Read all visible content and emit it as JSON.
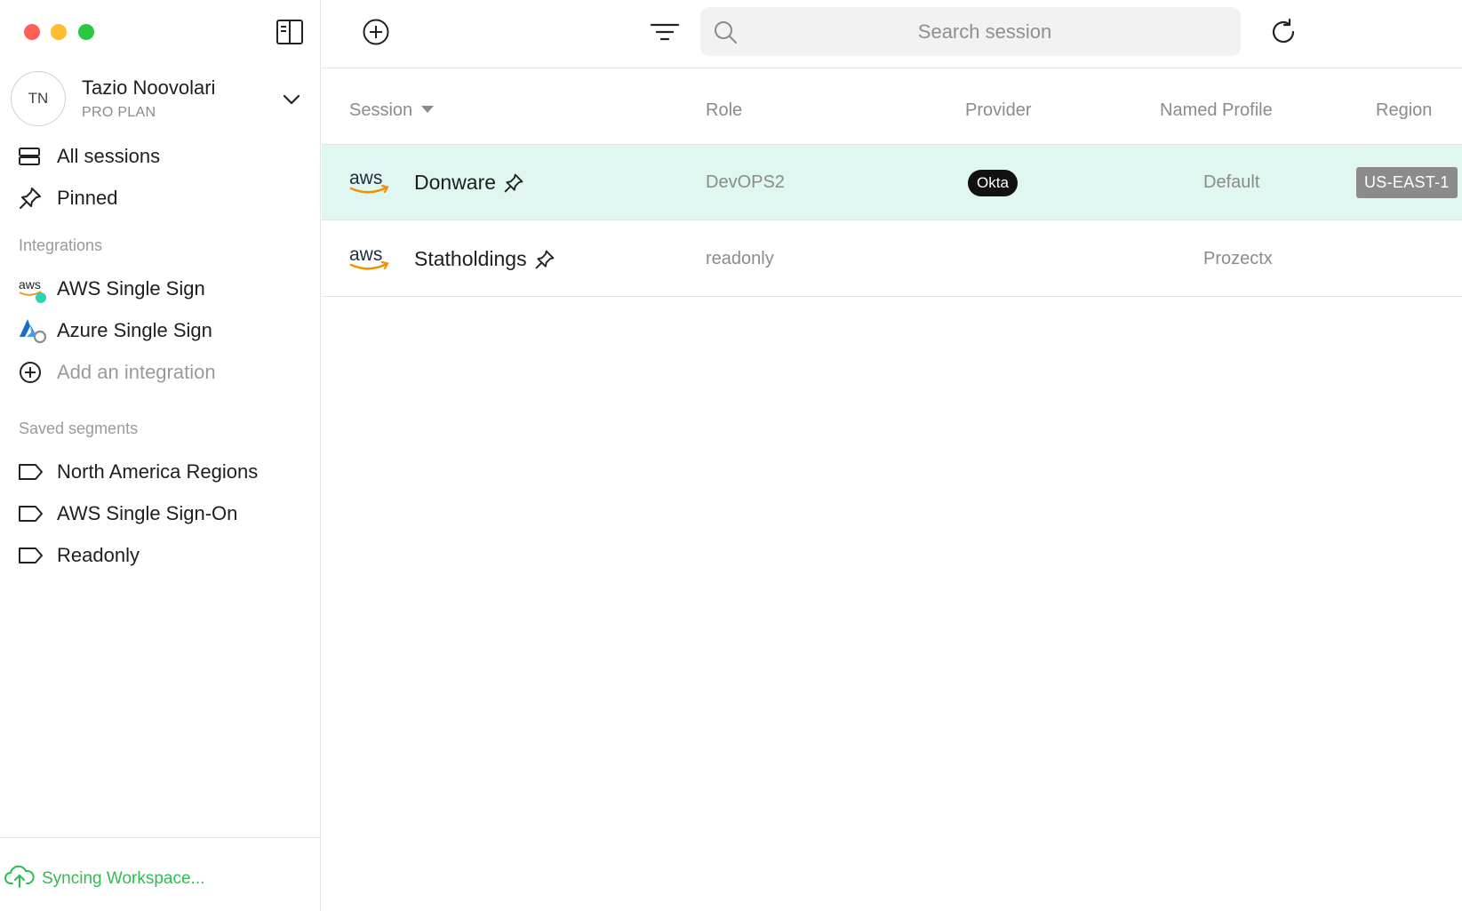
{
  "account": {
    "initials": "TN",
    "name": "Tazio Noovolari",
    "plan": "PRO PLAN"
  },
  "nav": {
    "all_sessions": "All sessions",
    "pinned": "Pinned"
  },
  "integrations": {
    "title": "Integrations",
    "items": [
      {
        "label": "AWS Single Sign",
        "icon": "aws-logo-icon",
        "status": "connected",
        "status_color": "#2ed1b0"
      },
      {
        "label": "Azure Single Sign",
        "icon": "azure-logo-icon",
        "status": "disconnected",
        "status_color": "#8b8b8b"
      }
    ],
    "add_label": "Add an integration"
  },
  "segments": {
    "title": "Saved segments",
    "items": [
      {
        "label": "North America Regions"
      },
      {
        "label": "AWS Single Sign-On"
      },
      {
        "label": "Readonly"
      }
    ]
  },
  "footer": {
    "sync_label": "Syncing Workspace...",
    "sync_color": "#2ebd4f"
  },
  "search": {
    "placeholder": "Search session",
    "value": ""
  },
  "table": {
    "columns": {
      "session": "Session",
      "role": "Role",
      "provider": "Provider",
      "named_profile": "Named Profile",
      "region": "Region"
    },
    "rows": [
      {
        "name": "Donware",
        "role": "DevOPS2",
        "provider": "Okta",
        "named_profile": "Default",
        "region": "US-EAST-1",
        "selected": true
      },
      {
        "name": "Statholdings",
        "role": "readonly",
        "provider": "",
        "named_profile": "Prozectx",
        "region": "",
        "selected": false
      }
    ]
  },
  "colors": {
    "selected_row": "#dff6f1",
    "accent": "#2ed1b0"
  }
}
